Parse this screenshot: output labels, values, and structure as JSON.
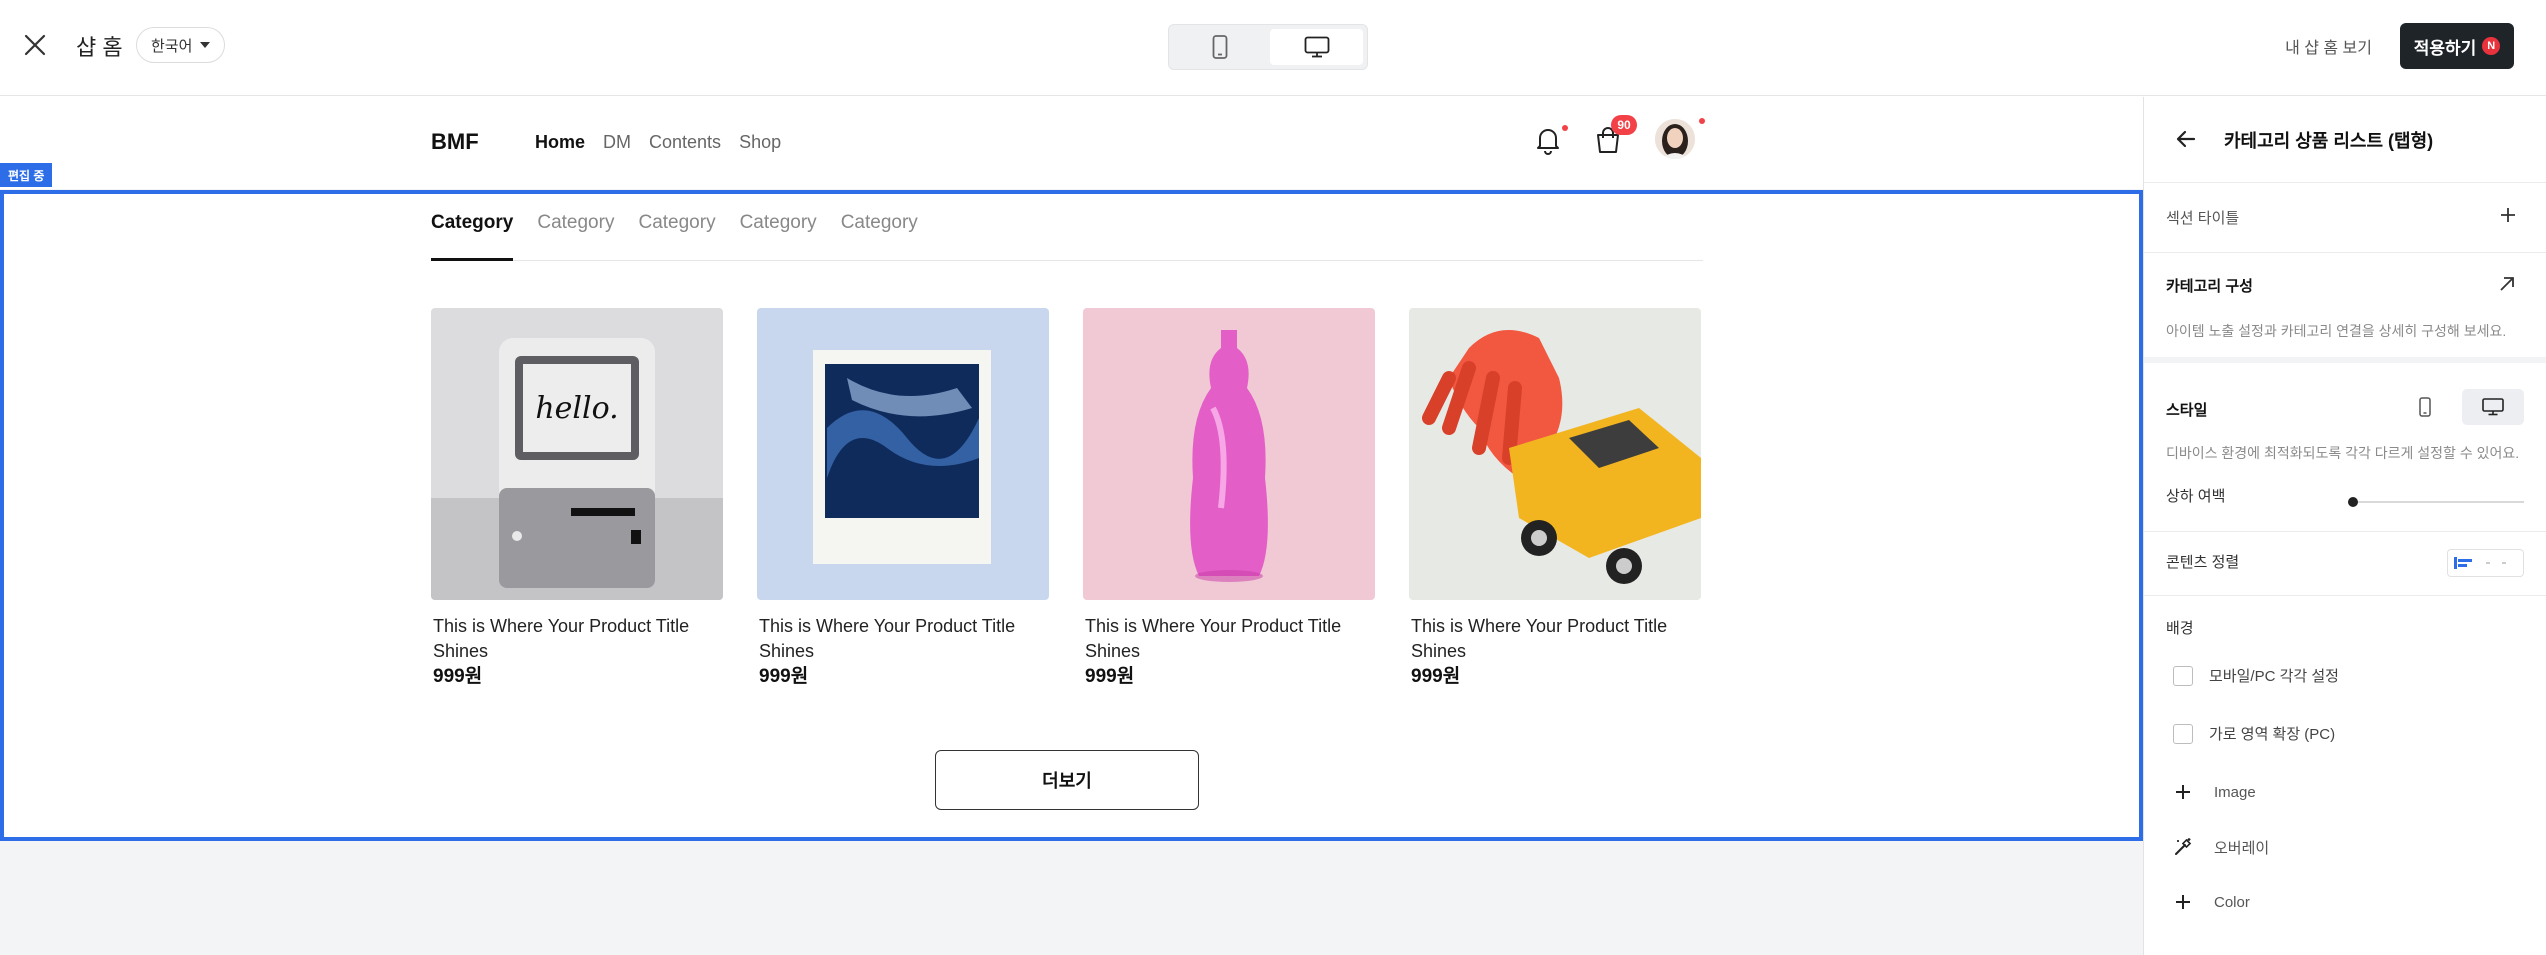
{
  "editor": {
    "title": "샵 홈",
    "language": "한국어",
    "my_shop_link": "내 샵 홈 보기",
    "apply_label": "적용하기",
    "apply_badge": "N"
  },
  "site": {
    "brand": "BMF",
    "nav": [
      "Home",
      "DM",
      "Contents",
      "Shop"
    ],
    "active_nav": "Home",
    "cart_count": "90"
  },
  "section": {
    "edit_tag": "편집 중",
    "tabs": [
      "Category",
      "Category",
      "Category",
      "Category",
      "Category"
    ],
    "active_tab": 0,
    "products": [
      {
        "title": "This is Where Your Product Title Shines",
        "price": "999원",
        "image": "retro-computer-hello"
      },
      {
        "title": "This is Where Your Product Title Shines",
        "price": "999원",
        "image": "polaroid-photo"
      },
      {
        "title": "This is Where Your Product Title Shines",
        "price": "999원",
        "image": "pink-glass-bottle"
      },
      {
        "title": "This is Where Your Product Title Shines",
        "price": "999원",
        "image": "red-hand-yellow-car"
      }
    ],
    "more_label": "더보기"
  },
  "panel": {
    "title": "카테고리 상품 리스트 (탭형)",
    "section_title_label": "섹션 타이틀",
    "category_config_label": "카테고리 구성",
    "category_config_desc": "아이템 노출 설정과 카테고리 연결을 상세히 구성해 보세요.",
    "style_label": "스타일",
    "style_desc": "디바이스 환경에 최적화되도록 각각 다르게 설정할 수 있어요.",
    "vertical_margin_label": "상하 여백",
    "vertical_margin_value": 0,
    "content_align_label": "콘텐츠 정렬",
    "background_label": "배경",
    "checkboxes": [
      {
        "label": "모바일/PC 각각 설정",
        "checked": false
      },
      {
        "label": "가로 영역 확장 (PC)",
        "checked": false
      }
    ],
    "background_options": [
      {
        "label": "Image",
        "icon": "plus-icon"
      },
      {
        "label": "오버레이",
        "icon": "magic-wand-icon"
      },
      {
        "label": "Color",
        "icon": "plus-icon"
      }
    ]
  },
  "colors": {
    "accent": "#2d6ee8",
    "apply_button": "#1f2429",
    "badge_red": "#f24147",
    "canvas_bg": "#f3f4f6"
  }
}
